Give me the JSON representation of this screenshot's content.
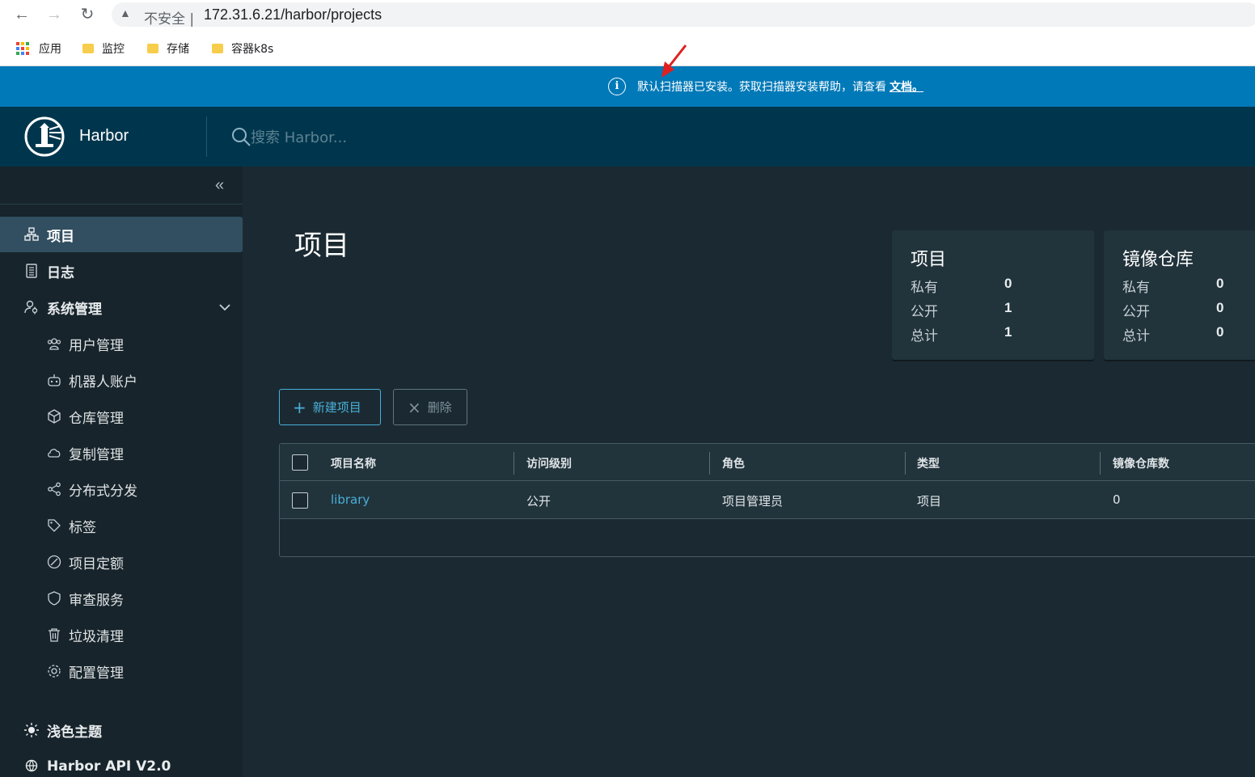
{
  "browser": {
    "insecure_label": "不安全 |",
    "url": "172.31.6.21/harbor/projects",
    "bookmarks": [
      {
        "label": "应用"
      },
      {
        "label": "监控"
      },
      {
        "label": "存储"
      },
      {
        "label": "容器k8s"
      }
    ]
  },
  "banner": {
    "message": "默认扫描器已安装。获取扫描器安装帮助，请查看",
    "link": "文档。",
    "color": "#0079b8"
  },
  "header": {
    "brand": "Harbor",
    "search_placeholder": "搜索 Harbor..."
  },
  "sidebar": {
    "items": [
      {
        "label": "项目",
        "icon": "projects-icon",
        "active": true
      },
      {
        "label": "日志",
        "icon": "logs-icon"
      },
      {
        "label": "系统管理",
        "icon": "admin-icon"
      }
    ],
    "sub_items": [
      {
        "label": "用户管理",
        "icon": "users-icon"
      },
      {
        "label": "机器人账户",
        "icon": "robot-icon"
      },
      {
        "label": "仓库管理",
        "icon": "registry-icon"
      },
      {
        "label": "复制管理",
        "icon": "replication-icon"
      },
      {
        "label": "分布式分发",
        "icon": "distribution-icon"
      },
      {
        "label": "标签",
        "icon": "tag-icon"
      },
      {
        "label": "项目定额",
        "icon": "quota-icon"
      },
      {
        "label": "审查服务",
        "icon": "shield-icon"
      },
      {
        "label": "垃圾清理",
        "icon": "trash-icon"
      },
      {
        "label": "配置管理",
        "icon": "gear-icon"
      }
    ],
    "theme": "浅色主题",
    "api": "Harbor API V2.0"
  },
  "main": {
    "title": "项目",
    "cards": [
      {
        "title": "项目",
        "rows": [
          {
            "label": "私有",
            "value": "0"
          },
          {
            "label": "公开",
            "value": "1"
          },
          {
            "label": "总计",
            "value": "1"
          }
        ]
      },
      {
        "title": "镜像仓库",
        "rows": [
          {
            "label": "私有",
            "value": "0"
          },
          {
            "label": "公开",
            "value": "0"
          },
          {
            "label": "总计",
            "value": "0"
          }
        ]
      }
    ],
    "new_button": "新建项目",
    "delete_button": "删除",
    "table": {
      "columns": [
        "项目名称",
        "访问级别",
        "角色",
        "类型",
        "镜像仓库数"
      ],
      "rows": [
        [
          "library",
          "公开",
          "项目管理员",
          "项目",
          "0"
        ]
      ]
    }
  }
}
